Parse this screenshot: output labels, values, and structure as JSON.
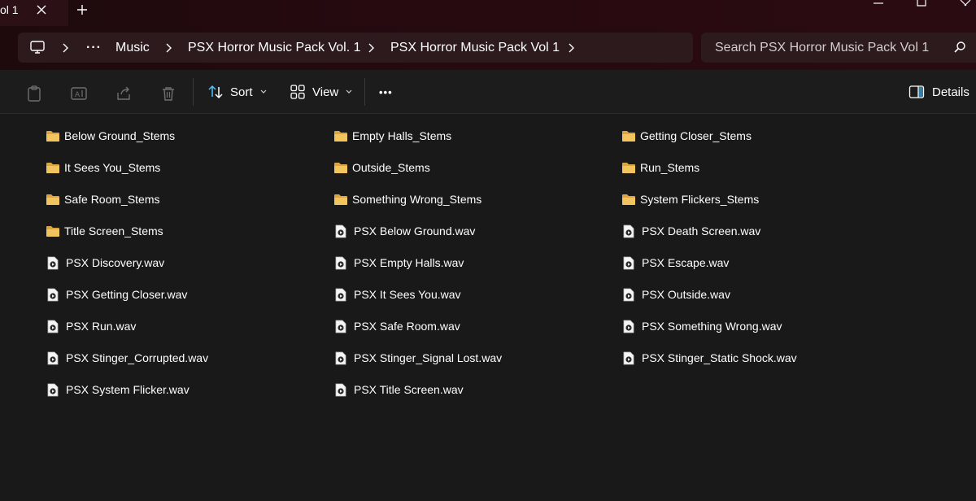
{
  "window": {
    "tab_title": "ol 1",
    "icons": [
      "close-icon",
      "plus-icon",
      "minimize-icon",
      "maximize-icon",
      "close-icon"
    ]
  },
  "breadcrumb": {
    "more": "···",
    "items": [
      "Music",
      "PSX Horror Music Pack Vol. 1",
      "PSX Horror Music Pack Vol 1"
    ]
  },
  "search": {
    "placeholder": "Search PSX Horror Music Pack Vol 1"
  },
  "toolbar": {
    "sort_label": "Sort",
    "view_label": "View",
    "more_label": "•••",
    "details_label": "Details"
  },
  "colors": {
    "accent": "#4cc2ff",
    "folder": "#e8b24a",
    "titlebar": "#260a10"
  },
  "files": [
    {
      "name": "Below Ground_Stems",
      "type": "folder"
    },
    {
      "name": "Empty Halls_Stems",
      "type": "folder"
    },
    {
      "name": "Getting Closer_Stems",
      "type": "folder"
    },
    {
      "name": "It Sees You_Stems",
      "type": "folder"
    },
    {
      "name": "Outside_Stems",
      "type": "folder"
    },
    {
      "name": "Run_Stems",
      "type": "folder"
    },
    {
      "name": "Safe Room_Stems",
      "type": "folder"
    },
    {
      "name": "Something Wrong_Stems",
      "type": "folder"
    },
    {
      "name": "System Flickers_Stems",
      "type": "folder"
    },
    {
      "name": "Title Screen_Stems",
      "type": "folder"
    },
    {
      "name": "PSX Below Ground.wav",
      "type": "audio"
    },
    {
      "name": "PSX Death Screen.wav",
      "type": "audio"
    },
    {
      "name": "PSX Discovery.wav",
      "type": "audio"
    },
    {
      "name": "PSX Empty Halls.wav",
      "type": "audio"
    },
    {
      "name": "PSX Escape.wav",
      "type": "audio"
    },
    {
      "name": "PSX Getting Closer.wav",
      "type": "audio"
    },
    {
      "name": "PSX It Sees You.wav",
      "type": "audio"
    },
    {
      "name": "PSX Outside.wav",
      "type": "audio"
    },
    {
      "name": "PSX Run.wav",
      "type": "audio"
    },
    {
      "name": "PSX Safe Room.wav",
      "type": "audio"
    },
    {
      "name": "PSX Something Wrong.wav",
      "type": "audio"
    },
    {
      "name": "PSX Stinger_Corrupted.wav",
      "type": "audio"
    },
    {
      "name": "PSX Stinger_Signal Lost.wav",
      "type": "audio"
    },
    {
      "name": "PSX Stinger_Static Shock.wav",
      "type": "audio"
    },
    {
      "name": "PSX System Flicker.wav",
      "type": "audio"
    },
    {
      "name": "PSX Title Screen.wav",
      "type": "audio"
    }
  ]
}
